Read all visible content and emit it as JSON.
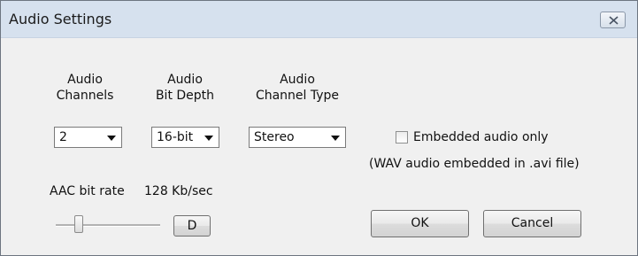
{
  "window": {
    "title": "Audio Settings"
  },
  "audio_channels": {
    "label_line1": "Audio",
    "label_line2": "Channels",
    "selected": "2"
  },
  "bit_depth": {
    "label_line1": "Audio",
    "label_line2": "Bit Depth",
    "selected": "16-bit"
  },
  "channel_type": {
    "label_line1": "Audio",
    "label_line2": "Channel Type",
    "selected": "Stereo"
  },
  "embedded": {
    "checkbox_label": "Embedded audio only",
    "checked": false,
    "note": "(WAV audio embedded in .avi file)"
  },
  "aac": {
    "label": "AAC bit rate",
    "value_text": "128 Kb/sec",
    "default_button_label": "D"
  },
  "buttons": {
    "ok_label": "OK",
    "cancel_label": "Cancel"
  }
}
